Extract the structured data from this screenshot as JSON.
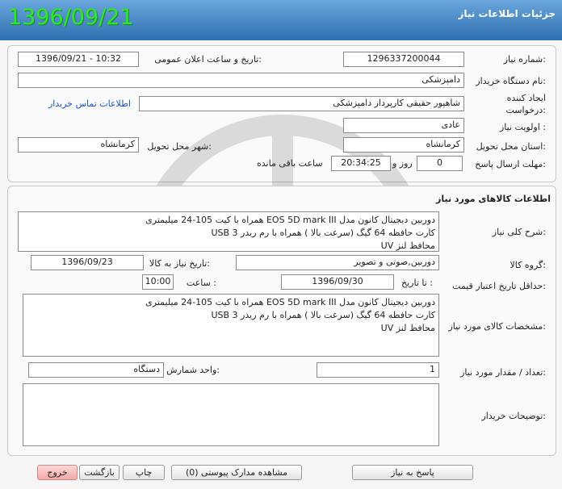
{
  "header": {
    "title": "جزئیات اطلاعات نیاز",
    "date_stamp": "1396/09/21"
  },
  "info": {
    "need_number_label": "شماره نیاز:",
    "need_number": "1296337200044",
    "announce_label": "تاریخ و ساعت اعلان عمومی:",
    "announce_value": "1396/09/21 - 10:32",
    "buyer_org_label": "نام دستگاه خریدار:",
    "buyer_org": "دامپزشکی",
    "creator_label_1": "ایجاد کننده",
    "creator_label_2": "درخواست:",
    "creator": "شاهپور حقیقی کارپرداز دامپزشکی",
    "contact_link": "اطلاعات تماس خریدار",
    "priority_label": "اولویت نیاز :",
    "priority": "عادی",
    "province_label": "استان محل تحویل:",
    "province": "کرمانشاه",
    "city_label": "شهر محل تحویل:",
    "city": "کرمانشاه",
    "deadline_label": "مهلت ارسال پاسخ:",
    "deadline_days": "0",
    "day_and": "روز و",
    "deadline_time": "20:34:25",
    "remaining": "ساعت باقی مانده"
  },
  "goods": {
    "section_title": "اطلاعات کالاهای مورد نیاز",
    "general_desc_label": "شرح کلی نیاز:",
    "general_desc": [
      "دوربین دیجیتال کانون مدل EOS 5D mark III همراه با کیت 105-24 میلیمتری",
      "کارت حافظه 64 گیگ (سرعت بالا ) همراه با رم ریدر USB 3",
      "محافظ لنز UV"
    ],
    "group_label": "گروه کالا:",
    "group": "دوربین,صوتی و تصویر",
    "need_date_label": "تاریخ نیاز به کالا:",
    "need_date": "1396/09/23",
    "price_valid_label": "حداقل تاریخ اعتبار قیمت:",
    "until_date_label": "تا تاریخ :",
    "until_date": "1396/09/30",
    "time_label": "ساعت :",
    "time": "10:00",
    "specs_label": "مشخصات کالای مورد نیاز:",
    "specs": [
      "دوربین دیجیتال کانون مدل EOS 5D mark III همراه با کیت 105-24 میلیمتری",
      "کارت حافظه 64 گیگ (سرعت بالا ) همراه با رم ریدر USB 3",
      "محافظ لنز UV"
    ],
    "qty_label": "تعداد / مقدار مورد نیاز:",
    "qty": "1",
    "unit_label": "واحد شمارش:",
    "unit": "دستگاه",
    "buyer_notes_label": "توضیحات خریدار:",
    "buyer_notes": ""
  },
  "buttons": {
    "reply": "پاسخ به نیاز",
    "attachments": "مشاهده مدارک پیوستی (0)",
    "print": "چاپ",
    "back": "بازگشت",
    "exit": "خروج"
  },
  "colors": {
    "header_bg": "#2f6fb0",
    "date_stamp": "#2ee62e",
    "link": "#1b55c9",
    "exit_btn": "#f3a9a9"
  }
}
